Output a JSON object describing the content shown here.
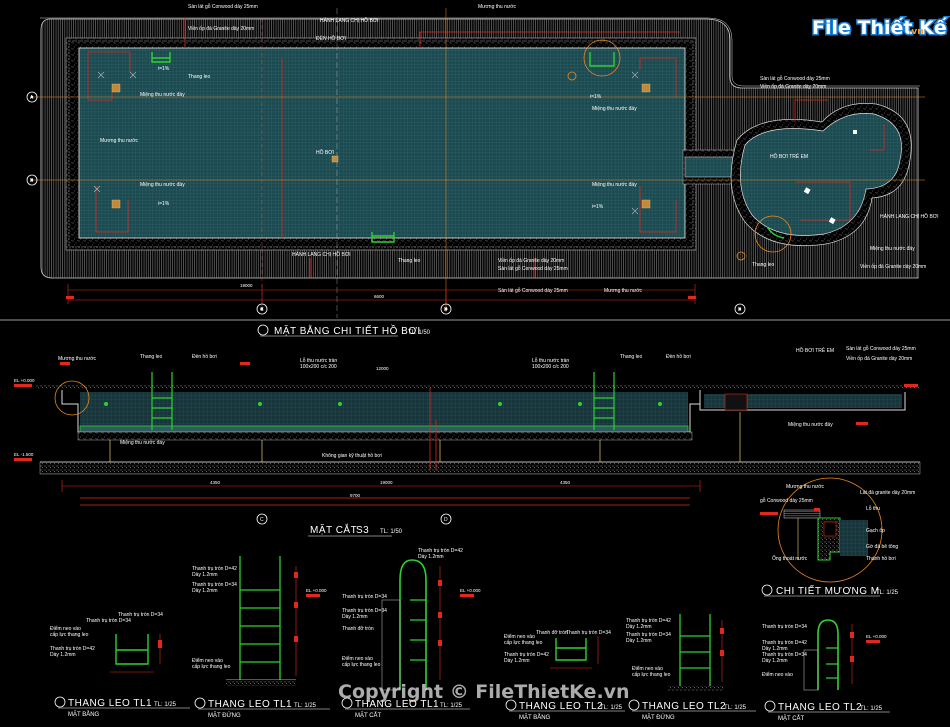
{
  "logo": {
    "file": "File",
    "thiet": "Thiết",
    "ke": "Kế",
    "vn": ".vn"
  },
  "watermark": "Copyright © FileThietKe.vn",
  "plan": {
    "title": "MẶT BẰNG CHI TIẾT HỒ BƠI",
    "scale": "TL: 1/50",
    "labels": {
      "deck_top": "Sàn lát gỗ Conwood dày 25mm",
      "border_top": "Viền ốp đá Granite dày 20mm",
      "gutter_top": "Mương thu nước",
      "stair": "Thang leo",
      "drain1": "Miệng thu nước đáy",
      "drain2": "Miệng thu nước đáy",
      "drain3": "Miệng thu nước đáy",
      "drain4": "Miệng thu nước đáy",
      "gutter_left": "Mương thu nước",
      "slope": "i=1%",
      "stair2": "Thang leo",
      "deck_bottom": "Sàn lát gỗ Conwood dày 25mm",
      "border_bottom": "Viền ốp đá Granite dày 20mm",
      "gutter_bottom": "Mương thu nước",
      "deck_right": "Sàn lát gỗ Conwood dày 25mm",
      "border_right": "Viền ốp đá Granite dày 20mm",
      "drain_right": "Miệng thu nước đáy",
      "stair_right": "Thang leo",
      "kid_pool": "HỒ BƠI TRẺ EM",
      "big_pool": "HỒ BƠI",
      "light1": "ĐÈN HỒ BƠI",
      "light2": "HÀNH LANG CHỊ HỒ BƠI"
    }
  },
  "section": {
    "title": "MẶT CẮT",
    "label": "S3",
    "scale": "TL: 1/50",
    "labels": {
      "gutter": "Mương thu nước",
      "stair_a": "Thang leo",
      "light_a": "Đèn hồ bơi",
      "overflow_a": "Lỗ thu nước tràn",
      "overflow_a_size": "100x200 c/c 200",
      "overflow_b": "Lỗ thu nước tràn",
      "overflow_b_size": "100x200 c/c 200",
      "stair_b": "Thang leo",
      "light_b": "Đèn hồ bơi",
      "deck": "Sàn lát gỗ Conwood dày 25mm",
      "border": "Viền ốp đá Granite dày 20mm",
      "drain_a": "Miệng thu nước đáy",
      "drain_b": "Miệng thu nước đáy",
      "note": "Không gian kỹ thuật hồ bơi",
      "kid": "HỒ BƠI TRẺ EM"
    }
  },
  "detail": {
    "title": "CHI TIẾT MƯƠNG M",
    "scale": "TL: 1/25",
    "labels": {
      "gutter": "Mương thu nước",
      "deck": "gỗ Conwood dày 25mm",
      "granite": "Lát đá granite dày 20mm",
      "grate": "Lỗ thu",
      "tile": "Gạch ốp",
      "pipe": "Ống thoát nước",
      "wall": "Gờ đá bê tông",
      "pool": "Thành hồ bơi"
    }
  },
  "ladders": [
    {
      "title": "THANG LEO TL1",
      "sub": "MẶT BẰNG",
      "scale": "TL: 1/25"
    },
    {
      "title": "THANG LEO TL1",
      "sub": "MẶT ĐỨNG",
      "scale": "TL: 1/25"
    },
    {
      "title": "THANG LEO TL1",
      "sub": "MẶT CẮT",
      "scale": "TL: 1/25"
    },
    {
      "title": "THANG LEO TL2",
      "sub": "MẶT BẰNG",
      "scale": "TL: 1/25"
    },
    {
      "title": "THANG LEO TL2",
      "sub": "MẶT ĐỨNG",
      "scale": "TL: 1/25"
    },
    {
      "title": "THANG LEO TL2",
      "sub": "MẶT CẮT",
      "scale": "TL: 1/25"
    }
  ],
  "ladder_notes": {
    "tube42": "Thanh trụ tròn D=42",
    "thick12": "Dày 1.2mm",
    "tube34": "Thanh trụ tròn D=34",
    "thick12b": "Dày 1.2mm",
    "step": "Thanh trụ tròn D=34",
    "anchor": "Điểm neo vào",
    "anchor2": "cấp lực thang leo",
    "bottom": "Thanh đỡ tròn"
  },
  "dims": {
    "plan_total": "19000",
    "plan_mid": "6600",
    "sec_total": "19000",
    "sec_mid": "9700",
    "sec_a": "4350",
    "sec_b": "4350",
    "pool_len": "12000",
    "d1": "1250",
    "d2": "2000",
    "d3": "1500"
  },
  "levels": {
    "top": "EL +0.000",
    "bottom": "EL -1.500",
    "lad1": "EL +0.000",
    "lad2": "EL +0.000",
    "lad3": "EL +0.000"
  },
  "axes": {
    "a": "A",
    "b": "B",
    "c": "C",
    "d": "D",
    "e": "E"
  }
}
